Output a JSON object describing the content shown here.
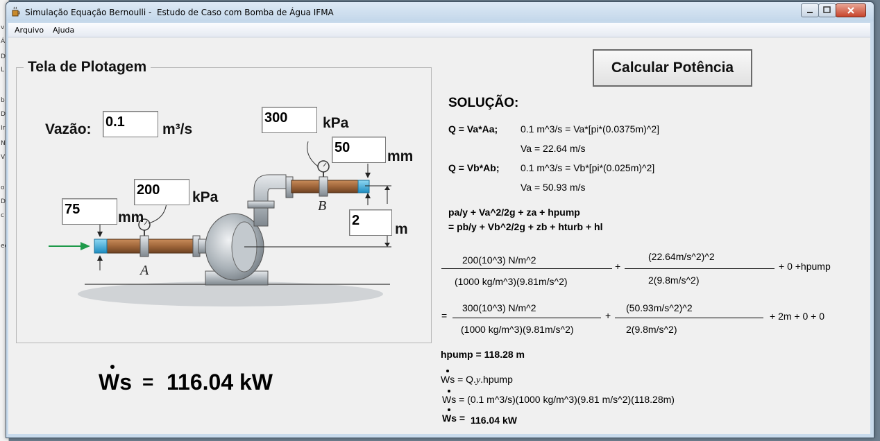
{
  "window": {
    "title": "Simulação Equação Bernoulli -  Estudo de Caso com Bomba de Água IFMA"
  },
  "menu": {
    "items": [
      "Arquivo",
      "Ajuda"
    ]
  },
  "plot": {
    "group_title": "Tela de Plotagem",
    "vazao_label": "Vazão:",
    "vazao_value": "0.1",
    "vazao_unit": "m³/s",
    "pa_value": "200",
    "pa_unit": "kPa",
    "pb_value": "300",
    "pb_unit": "kPa",
    "da_value": "75",
    "da_unit": "mm",
    "db_value": "50",
    "db_unit": "mm",
    "z_value": "2",
    "z_unit": "m",
    "point_a": "A",
    "point_b": "B"
  },
  "result": {
    "ws_symbol": "Ws",
    "ws_equals": "=",
    "ws_value": "116.04 kW"
  },
  "calc_button": "Calcular Potência",
  "solution": {
    "heading": "SOLUÇÃO:",
    "qa_label": "Q = Va*Aa;",
    "qa_eq": "0.1 m^3/s = Va*[pi*(0.0375m)^2]",
    "va_a": "Va = 22.64 m/s",
    "qb_label": "Q = Vb*Ab;",
    "qb_eq": "0.1 m^3/s = Vb*[pi*(0.025m)^2]",
    "va_b": "Va = 50.93 m/s",
    "bern_1": "pa/y + Va^2/2g + za + hpump",
    "bern_2": "= pb/y + Vb^2/2g + zb + hturb + hl",
    "f1_num": "200(10^3) N/m^2",
    "f1_den": "(1000 kg/m^3)(9.81m/s^2)",
    "plus": "+",
    "f2_num": "(22.64m/s^2)^2",
    "f2_den": "2(9.8m/s^2)",
    "tail_1": "+ 0 +hpump",
    "eq_sign": "=",
    "f3_num": "300(10^3) N/m^2",
    "f3_den": "(1000 kg/m^3)(9.81m/s^2)",
    "f4_num": "(50.93m/s^2)^2",
    "f4_den": "2(9.8m/s^2)",
    "tail_2": "+  2m + 0 + 0",
    "hpump": "hpump = 118.28 m",
    "ws_1": "Ws = Q.",
    "ws_1_y": "y",
    "ws_1_b": ".hpump",
    "ws_2": "Ws = (0.1 m^3/s)(1000 kg/m^3)(9.81 m/s^2)(118.28m)",
    "ws_3_sym": "Ws =",
    "ws_3_val": "116.04 kW"
  },
  "colors": {
    "pipe": "#a0663a",
    "water": "#36a9d6",
    "arrow": "#1e9a4a",
    "pump": "#9aa3ab"
  }
}
